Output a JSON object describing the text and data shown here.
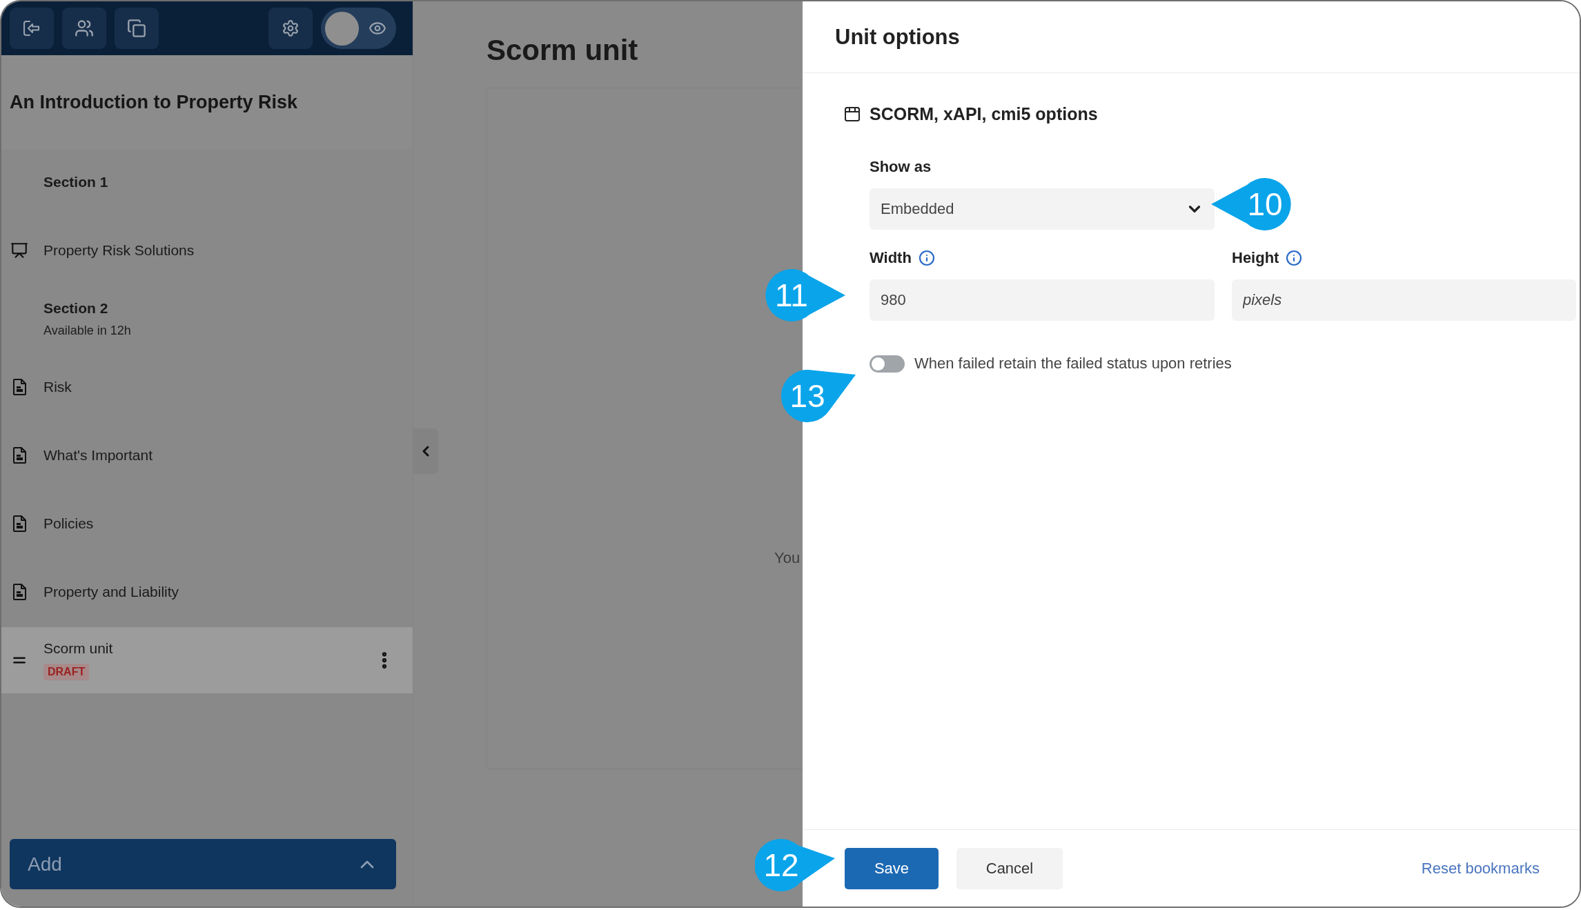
{
  "toolbar": {
    "preview_toggle": {
      "on": false
    }
  },
  "course": {
    "title": "An Introduction to Property Risk"
  },
  "outline": [
    {
      "kind": "section",
      "title": "Section 1",
      "selected": false
    },
    {
      "kind": "presentation",
      "title": "Property Risk Solutions",
      "selected": false
    },
    {
      "kind": "section",
      "title": "Section 2",
      "subtitle": "Available in 12h",
      "selected": false
    },
    {
      "kind": "document",
      "title": "Risk",
      "selected": false
    },
    {
      "kind": "document",
      "title": "What's Important",
      "selected": false
    },
    {
      "kind": "document",
      "title": "Policies",
      "selected": false
    },
    {
      "kind": "document",
      "title": "Property and Liability",
      "selected": false
    },
    {
      "kind": "scorm",
      "title": "Scorm unit",
      "badge": "DRAFT",
      "selected": true
    }
  ],
  "add_button": {
    "label": "Add"
  },
  "unit": {
    "title": "Scorm unit",
    "frame_text": "You"
  },
  "panel": {
    "title": "Unit options",
    "section_title": "SCORM, xAPI, cmi5 options",
    "show_as": {
      "label": "Show as",
      "value": "Embedded",
      "callout": "10"
    },
    "width": {
      "label": "Width",
      "value": "980",
      "callout": "11"
    },
    "height": {
      "label": "Height",
      "placeholder": "pixels"
    },
    "retain_failed": {
      "label": "When failed retain the failed status upon retries",
      "on": false,
      "callout": "13"
    }
  },
  "footer": {
    "save": {
      "label": "Save",
      "callout": "12"
    },
    "cancel": {
      "label": "Cancel"
    },
    "reset": {
      "label": "Reset bookmarks"
    }
  }
}
